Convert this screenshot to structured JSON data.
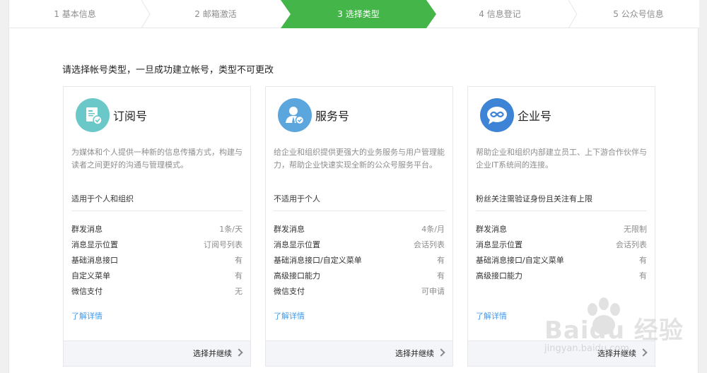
{
  "steps": [
    {
      "label": "1 基本信息",
      "active": false
    },
    {
      "label": "2 邮箱激活",
      "active": false
    },
    {
      "label": "3 选择类型",
      "active": true
    },
    {
      "label": "4 信息登记",
      "active": false
    },
    {
      "label": "5 公众号信息",
      "active": false
    }
  ],
  "colors": {
    "accent": "#44b549",
    "link": "#459ae9"
  },
  "intro": "请选择帐号类型，一旦成功建立帐号，类型不可更改",
  "cards": [
    {
      "title": "订阅号",
      "icon": "subscription-icon",
      "icon_color": "#6bc8c8",
      "desc": "为媒体和个人提供一种新的信息传播方式，构建与读者之间更好的沟通与管理模式。",
      "note": "适用于个人和组织",
      "features": [
        {
          "name": "群发消息",
          "value": "1条/天"
        },
        {
          "name": "消息显示位置",
          "value": "订阅号列表"
        },
        {
          "name": "基础消息接口",
          "value": "有"
        },
        {
          "name": "自定义菜单",
          "value": "有"
        },
        {
          "name": "微信支付",
          "value": "无"
        }
      ],
      "more": "了解详情",
      "action": "选择并继续"
    },
    {
      "title": "服务号",
      "icon": "service-icon",
      "icon_color": "#5ba6dc",
      "desc": "给企业和组织提供更强大的业务服务与用户管理能力，帮助企业快速实现全新的公众号服务平台。",
      "note": "不适用于个人",
      "features": [
        {
          "name": "群发消息",
          "value": "4条/月"
        },
        {
          "name": "消息显示位置",
          "value": "会话列表"
        },
        {
          "name": "基础消息接口/自定义菜单",
          "value": "有"
        },
        {
          "name": "高级接口能力",
          "value": "有"
        },
        {
          "name": "微信支付",
          "value": "可申请"
        }
      ],
      "more": "了解详情",
      "action": "选择并继续"
    },
    {
      "title": "企业号",
      "icon": "enterprise-icon",
      "icon_color": "#3d84d6",
      "desc": "帮助企业和组织内部建立员工、上下游合作伙伴与企业IT系统间的连接。",
      "note": "粉丝关注需验证身份且关注有上限",
      "features": [
        {
          "name": "群发消息",
          "value": "无限制"
        },
        {
          "name": "消息显示位置",
          "value": "会话列表"
        },
        {
          "name": "基础消息接口/自定义菜单",
          "value": "有"
        },
        {
          "name": "高级接口能力",
          "value": "有"
        }
      ],
      "more": "了解详情",
      "action": "选择并继续"
    }
  ],
  "watermark": {
    "text": "Baidu 经验",
    "sub": "jingyan.baidu.com"
  }
}
